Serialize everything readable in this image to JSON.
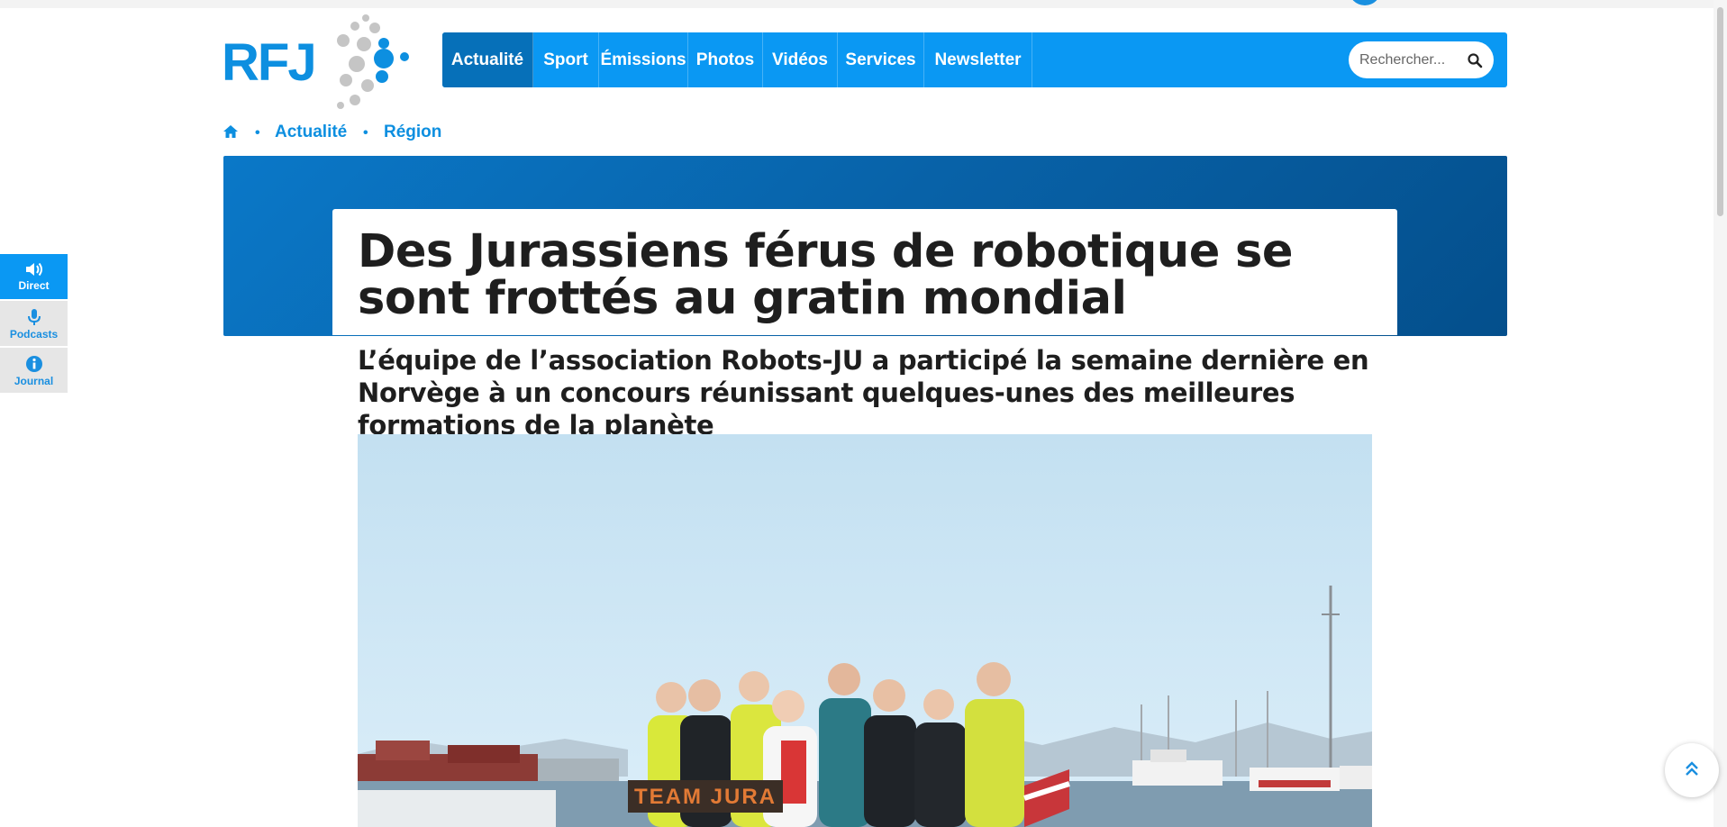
{
  "logo": {
    "text": "RFJ"
  },
  "nav": {
    "items": [
      {
        "label": "Actualité",
        "active": true
      },
      {
        "label": "Sport"
      },
      {
        "label": "Émissions"
      },
      {
        "label": "Photos"
      },
      {
        "label": "Vidéos"
      },
      {
        "label": "Services"
      },
      {
        "label": "Newsletter"
      }
    ],
    "search_placeholder": "Rechercher..."
  },
  "breadcrumb": {
    "home_icon": "home-icon",
    "items": [
      "Actualité",
      "Région"
    ]
  },
  "article": {
    "title": "Des Jurassiens férus de robotique se sont frottés au gratin mondial",
    "subtitle": "L’équipe de l’association Robots-JU a participé la semaine dernière en Norvège à un concours réunissant quelques-unes des meilleures formations de la planète",
    "photo_sign": "TEAM JURA"
  },
  "side_tabs": [
    {
      "label": "Direct",
      "icon": "speaker-icon",
      "active": true
    },
    {
      "label": "Podcasts",
      "icon": "microphone-icon"
    },
    {
      "label": "Journal",
      "icon": "info-icon"
    }
  ],
  "colors": {
    "brand": "#0a98f3",
    "brand_dark": "#0670b9",
    "hero": "#0862a8",
    "text": "#1e1e1e"
  }
}
